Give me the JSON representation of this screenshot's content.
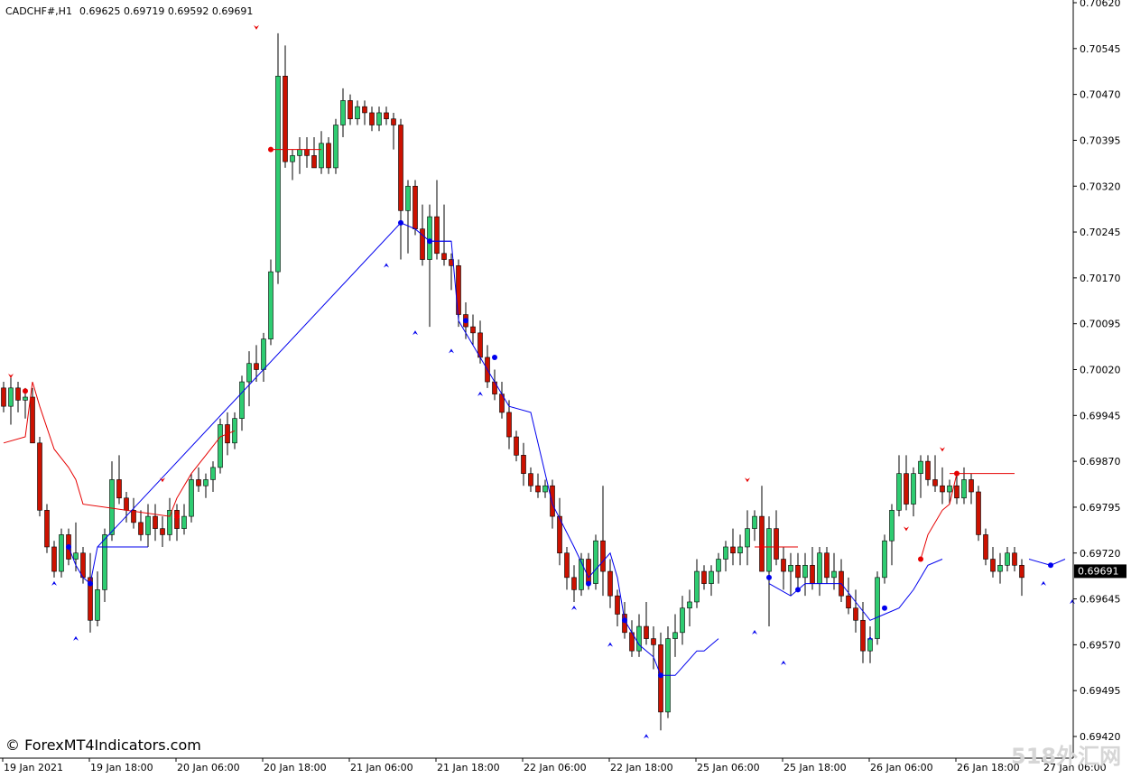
{
  "header": {
    "symbol": "CADCHF#,H1",
    "ohlc": "0.69625 0.69719 0.69592 0.69691"
  },
  "watermark": {
    "left": "© ForexMT4Indicators.com",
    "right": "518外汇网"
  },
  "colors": {
    "background": "#ffffff",
    "axis": "#000000",
    "bull_body": "#2ecc71",
    "bear_body": "#cc1100",
    "wick": "#000000",
    "resistance": "#e60000",
    "support": "#0000ee",
    "price_tag_bg": "#000000",
    "price_tag_fg": "#ffffff"
  },
  "chart_data": {
    "type": "candlestick",
    "ylim": [
      0.6942,
      0.7062
    ],
    "y_ticks": [
      "0.70620",
      "0.70545",
      "0.70470",
      "0.70395",
      "0.70320",
      "0.70245",
      "0.70170",
      "0.70095",
      "0.70020",
      "0.69945",
      "0.69870",
      "0.69795",
      "0.69720",
      "0.69645",
      "0.69570",
      "0.69495",
      "0.69420"
    ],
    "x_ticks": [
      "19 Jan 2021",
      "19 Jan 18:00",
      "20 Jan 06:00",
      "20 Jan 18:00",
      "21 Jan 06:00",
      "21 Jan 18:00",
      "22 Jan 06:00",
      "22 Jan 18:00",
      "25 Jan 06:00",
      "25 Jan 18:00",
      "26 Jan 06:00",
      "26 Jan 18:00",
      "27 Jan 06:00"
    ],
    "bar_spacing_px": 8.0,
    "last_price": "0.69691",
    "candles": [
      [
        0.6999,
        0.7,
        0.6995,
        0.6996
      ],
      [
        0.6996,
        0.7001,
        0.6993,
        0.6999
      ],
      [
        0.6999,
        0.7,
        0.6995,
        0.6997
      ],
      [
        0.6997,
        0.6999,
        0.6994,
        0.69975
      ],
      [
        0.69975,
        0.6999,
        0.699,
        0.699
      ],
      [
        0.699,
        0.6991,
        0.6978,
        0.6979
      ],
      [
        0.6979,
        0.698,
        0.6972,
        0.6973
      ],
      [
        0.6973,
        0.6974,
        0.6968,
        0.6969
      ],
      [
        0.6969,
        0.6976,
        0.6968,
        0.6975
      ],
      [
        0.6975,
        0.6976,
        0.697,
        0.6971
      ],
      [
        0.6971,
        0.6977,
        0.6969,
        0.6972
      ],
      [
        0.6972,
        0.6973,
        0.6967,
        0.6968
      ],
      [
        0.6968,
        0.6972,
        0.6959,
        0.6961
      ],
      [
        0.6961,
        0.6969,
        0.696,
        0.6966
      ],
      [
        0.6966,
        0.6976,
        0.6964,
        0.6975
      ],
      [
        0.6975,
        0.6987,
        0.6974,
        0.6984
      ],
      [
        0.6984,
        0.6988,
        0.698,
        0.6981
      ],
      [
        0.6981,
        0.6982,
        0.6977,
        0.6979
      ],
      [
        0.6979,
        0.6981,
        0.6976,
        0.6977
      ],
      [
        0.6977,
        0.6979,
        0.6974,
        0.6975
      ],
      [
        0.6975,
        0.698,
        0.6973,
        0.6978
      ],
      [
        0.6978,
        0.698,
        0.6974,
        0.6976
      ],
      [
        0.6976,
        0.6978,
        0.6973,
        0.6975
      ],
      [
        0.6975,
        0.6981,
        0.6974,
        0.6979
      ],
      [
        0.6979,
        0.698,
        0.6974,
        0.6976
      ],
      [
        0.6976,
        0.698,
        0.6975,
        0.6978
      ],
      [
        0.6978,
        0.6985,
        0.6977,
        0.6984
      ],
      [
        0.6984,
        0.6986,
        0.6982,
        0.6983
      ],
      [
        0.6983,
        0.6985,
        0.6981,
        0.6984
      ],
      [
        0.6984,
        0.6987,
        0.6982,
        0.6986
      ],
      [
        0.6986,
        0.6994,
        0.6985,
        0.6993
      ],
      [
        0.6993,
        0.6995,
        0.6988,
        0.699
      ],
      [
        0.699,
        0.6995,
        0.6989,
        0.6994
      ],
      [
        0.6994,
        0.7001,
        0.6992,
        0.7
      ],
      [
        0.7,
        0.7005,
        0.6996,
        0.7003
      ],
      [
        0.7003,
        0.7006,
        0.7,
        0.7002
      ],
      [
        0.7002,
        0.7008,
        0.7,
        0.7007
      ],
      [
        0.7007,
        0.702,
        0.7006,
        0.7018
      ],
      [
        0.7018,
        0.7057,
        0.7016,
        0.705
      ],
      [
        0.705,
        0.7055,
        0.7035,
        0.7036
      ],
      [
        0.7036,
        0.7038,
        0.7033,
        0.7037
      ],
      [
        0.7037,
        0.704,
        0.7034,
        0.7038
      ],
      [
        0.7038,
        0.704,
        0.7035,
        0.7037
      ],
      [
        0.7037,
        0.704,
        0.7035,
        0.7035
      ],
      [
        0.7035,
        0.7041,
        0.7034,
        0.7039
      ],
      [
        0.7039,
        0.704,
        0.7034,
        0.7035
      ],
      [
        0.7035,
        0.7043,
        0.7034,
        0.7042
      ],
      [
        0.7042,
        0.7048,
        0.704,
        0.7046
      ],
      [
        0.7046,
        0.7047,
        0.7042,
        0.7043
      ],
      [
        0.7043,
        0.7046,
        0.7042,
        0.7045
      ],
      [
        0.7045,
        0.7046,
        0.7042,
        0.7044
      ],
      [
        0.7044,
        0.7045,
        0.7041,
        0.7042
      ],
      [
        0.7042,
        0.7045,
        0.7041,
        0.7044
      ],
      [
        0.7044,
        0.7045,
        0.7042,
        0.7043
      ],
      [
        0.7043,
        0.7044,
        0.7038,
        0.7042
      ],
      [
        0.7042,
        0.7043,
        0.702,
        0.7028
      ],
      [
        0.7028,
        0.7033,
        0.7021,
        0.7032
      ],
      [
        0.7032,
        0.7033,
        0.7024,
        0.7025
      ],
      [
        0.7025,
        0.7029,
        0.7019,
        0.702
      ],
      [
        0.702,
        0.7029,
        0.7009,
        0.7027
      ],
      [
        0.7027,
        0.7033,
        0.702,
        0.7021
      ],
      [
        0.7021,
        0.7029,
        0.7019,
        0.702
      ],
      [
        0.702,
        0.7021,
        0.7015,
        0.7019
      ],
      [
        0.7019,
        0.702,
        0.7009,
        0.7011
      ],
      [
        0.7011,
        0.7013,
        0.7007,
        0.7009
      ],
      [
        0.7009,
        0.7011,
        0.7006,
        0.7008
      ],
      [
        0.7008,
        0.701,
        0.7003,
        0.7004
      ],
      [
        0.7004,
        0.7006,
        0.6999,
        0.7
      ],
      [
        0.7,
        0.7002,
        0.6997,
        0.6998
      ],
      [
        0.6998,
        0.7,
        0.6994,
        0.6995
      ],
      [
        0.6995,
        0.6997,
        0.6989,
        0.6991
      ],
      [
        0.6991,
        0.6992,
        0.6987,
        0.6988
      ],
      [
        0.6988,
        0.699,
        0.6983,
        0.6985
      ],
      [
        0.6985,
        0.6986,
        0.6982,
        0.6983
      ],
      [
        0.6983,
        0.6985,
        0.6981,
        0.6982
      ],
      [
        0.6982,
        0.6984,
        0.6981,
        0.6983
      ],
      [
        0.6983,
        0.6984,
        0.6976,
        0.6978
      ],
      [
        0.6978,
        0.6981,
        0.697,
        0.6972
      ],
      [
        0.6972,
        0.6973,
        0.6966,
        0.6968
      ],
      [
        0.6968,
        0.697,
        0.6964,
        0.6966
      ],
      [
        0.6966,
        0.6972,
        0.6965,
        0.6971
      ],
      [
        0.6971,
        0.6972,
        0.6966,
        0.6967
      ],
      [
        0.6967,
        0.6975,
        0.6966,
        0.6974
      ],
      [
        0.6974,
        0.6983,
        0.6965,
        0.6969
      ],
      [
        0.6969,
        0.6971,
        0.6963,
        0.6965
      ],
      [
        0.6965,
        0.6966,
        0.696,
        0.6962
      ],
      [
        0.6962,
        0.6964,
        0.6958,
        0.6959
      ],
      [
        0.6959,
        0.6961,
        0.6955,
        0.6956
      ],
      [
        0.6956,
        0.6962,
        0.6955,
        0.696
      ],
      [
        0.696,
        0.6964,
        0.6957,
        0.6958
      ],
      [
        0.6958,
        0.696,
        0.6953,
        0.6957
      ],
      [
        0.6957,
        0.6959,
        0.6943,
        0.6946
      ],
      [
        0.6946,
        0.696,
        0.6945,
        0.6958
      ],
      [
        0.6958,
        0.6962,
        0.6955,
        0.6959
      ],
      [
        0.6959,
        0.6965,
        0.6957,
        0.6963
      ],
      [
        0.6963,
        0.6966,
        0.696,
        0.6964
      ],
      [
        0.6964,
        0.6971,
        0.6963,
        0.6969
      ],
      [
        0.6969,
        0.697,
        0.6966,
        0.6967
      ],
      [
        0.6967,
        0.697,
        0.6965,
        0.6969
      ],
      [
        0.6969,
        0.6972,
        0.6967,
        0.6971
      ],
      [
        0.6971,
        0.6974,
        0.6969,
        0.6973
      ],
      [
        0.6973,
        0.6976,
        0.697,
        0.6972
      ],
      [
        0.6972,
        0.6975,
        0.697,
        0.6973
      ],
      [
        0.6973,
        0.6979,
        0.697,
        0.6976
      ],
      [
        0.6976,
        0.6979,
        0.6974,
        0.6978
      ],
      [
        0.6978,
        0.6983,
        0.6969,
        0.6969
      ],
      [
        0.6969,
        0.6978,
        0.696,
        0.6976
      ],
      [
        0.6976,
        0.6979,
        0.697,
        0.6971
      ],
      [
        0.6971,
        0.6973,
        0.6966,
        0.6969
      ],
      [
        0.6969,
        0.6972,
        0.6965,
        0.697
      ],
      [
        0.697,
        0.6972,
        0.6966,
        0.6968
      ],
      [
        0.6968,
        0.6972,
        0.6965,
        0.697
      ],
      [
        0.697,
        0.6973,
        0.6966,
        0.6967
      ],
      [
        0.6967,
        0.6973,
        0.6965,
        0.6972
      ],
      [
        0.6972,
        0.6973,
        0.6967,
        0.6968
      ],
      [
        0.6968,
        0.6972,
        0.6966,
        0.6969
      ],
      [
        0.6969,
        0.6971,
        0.6964,
        0.6965
      ],
      [
        0.6965,
        0.6968,
        0.6962,
        0.6963
      ],
      [
        0.6963,
        0.6966,
        0.6959,
        0.6961
      ],
      [
        0.6961,
        0.6964,
        0.6954,
        0.6956
      ],
      [
        0.6956,
        0.696,
        0.6954,
        0.6958
      ],
      [
        0.6958,
        0.6969,
        0.6957,
        0.6968
      ],
      [
        0.6968,
        0.6975,
        0.6967,
        0.6974
      ],
      [
        0.6974,
        0.698,
        0.697,
        0.6979
      ],
      [
        0.6979,
        0.6988,
        0.6978,
        0.6985
      ],
      [
        0.6985,
        0.6988,
        0.6979,
        0.698
      ],
      [
        0.698,
        0.6986,
        0.6978,
        0.6985
      ],
      [
        0.6985,
        0.6988,
        0.6981,
        0.6987
      ],
      [
        0.6987,
        0.6988,
        0.6983,
        0.6984
      ],
      [
        0.6984,
        0.6988,
        0.6982,
        0.6983
      ],
      [
        0.6983,
        0.6986,
        0.698,
        0.6982
      ],
      [
        0.6982,
        0.6984,
        0.698,
        0.6983
      ],
      [
        0.6983,
        0.6985,
        0.698,
        0.6981
      ],
      [
        0.6981,
        0.6986,
        0.698,
        0.6984
      ],
      [
        0.6984,
        0.6985,
        0.698,
        0.6982
      ],
      [
        0.6982,
        0.6983,
        0.6974,
        0.6975
      ],
      [
        0.6975,
        0.6976,
        0.697,
        0.6971
      ],
      [
        0.6971,
        0.6973,
        0.6968,
        0.6969
      ],
      [
        0.6969,
        0.6972,
        0.6967,
        0.697
      ],
      [
        0.697,
        0.6973,
        0.6969,
        0.6972
      ],
      [
        0.6972,
        0.6973,
        0.6969,
        0.697
      ],
      [
        0.697,
        0.6971,
        0.6965,
        0.6968
      ]
    ],
    "resistance_line": [
      [
        0,
        0.699
      ],
      [
        3,
        0.6991
      ],
      [
        4,
        0.7
      ],
      [
        5,
        0.6996
      ],
      [
        7,
        0.6989
      ],
      [
        9,
        0.6986
      ],
      [
        10,
        0.6984
      ],
      [
        11,
        0.698
      ],
      [
        23,
        0.6978
      ],
      [
        24,
        0.6981
      ],
      [
        26,
        0.6985
      ],
      [
        28,
        0.6988
      ],
      [
        30,
        0.6991
      ],
      [
        32,
        0.6992
      ]
    ],
    "resistance_steps": [
      [
        37,
        44,
        0.7038
      ],
      [
        104,
        110,
        0.6973
      ],
      [
        131,
        140,
        0.6985
      ]
    ],
    "resistance_dots": [
      [
        3,
        0.69985
      ],
      [
        24,
        0.6978
      ],
      [
        37,
        0.7038
      ],
      [
        105,
        0.6973
      ],
      [
        127,
        0.6971
      ],
      [
        132,
        0.6985
      ]
    ],
    "resistance_curve2": [
      [
        127,
        0.6971
      ],
      [
        128,
        0.6975
      ],
      [
        130,
        0.6979
      ],
      [
        131,
        0.698
      ],
      [
        132,
        0.6985
      ]
    ],
    "support_steps": [
      [
        13,
        20,
        0.6973
      ],
      [
        59,
        62,
        0.7023
      ]
    ],
    "support_line": [
      [
        9,
        0.6973
      ],
      [
        10,
        0.697
      ],
      [
        11,
        0.6968
      ],
      [
        12,
        0.6967
      ],
      [
        13,
        0.6973
      ],
      [
        55,
        0.7026
      ],
      [
        57,
        0.7025
      ],
      [
        59,
        0.7023
      ],
      [
        62,
        0.7023
      ],
      [
        63,
        0.701
      ],
      [
        64,
        0.7008
      ],
      [
        66,
        0.7004
      ],
      [
        70,
        0.6996
      ],
      [
        73,
        0.6995
      ],
      [
        75,
        0.6985
      ],
      [
        76,
        0.698
      ],
      [
        79,
        0.6973
      ],
      [
        81,
        0.6968
      ],
      [
        84,
        0.6972
      ],
      [
        85,
        0.6968
      ],
      [
        86,
        0.6961
      ],
      [
        88,
        0.6957
      ],
      [
        90,
        0.6955
      ],
      [
        91,
        0.6952
      ],
      [
        93,
        0.6952
      ],
      [
        96,
        0.6956
      ],
      [
        97,
        0.6956
      ],
      [
        99,
        0.6958
      ]
    ],
    "support_line2": [
      [
        106,
        0.6967
      ],
      [
        109,
        0.6965
      ],
      [
        111,
        0.6967
      ],
      [
        114,
        0.6967
      ],
      [
        116,
        0.6967
      ],
      [
        118,
        0.6964
      ],
      [
        120,
        0.6961
      ],
      [
        122,
        0.6962
      ],
      [
        124,
        0.6963
      ],
      [
        126,
        0.6966
      ],
      [
        128,
        0.697
      ],
      [
        130,
        0.6971
      ]
    ],
    "support_dots": [
      [
        9,
        0.6973
      ],
      [
        12,
        0.6967
      ],
      [
        55,
        0.7026
      ],
      [
        59,
        0.7023
      ],
      [
        64,
        0.701
      ],
      [
        68,
        0.7004
      ],
      [
        81,
        0.6967
      ],
      [
        86,
        0.6961
      ],
      [
        91,
        0.6952
      ],
      [
        106,
        0.6968
      ],
      [
        110,
        0.6966
      ],
      [
        122,
        0.6963
      ],
      [
        145,
        0.697
      ]
    ],
    "support_lines3": [
      [
        142,
        0.6971
      ],
      [
        145,
        0.697
      ],
      [
        147,
        0.6971
      ]
    ],
    "fractal_up": [
      [
        1,
        0.7
      ],
      [
        22,
        0.6983
      ],
      [
        35,
        0.7057
      ],
      [
        103,
        0.6983
      ],
      [
        125,
        0.6975
      ],
      [
        130,
        0.6988
      ]
    ],
    "fractal_down": [
      [
        7,
        0.6968
      ],
      [
        10,
        0.6959
      ],
      [
        53,
        0.702
      ],
      [
        57,
        0.7009
      ],
      [
        62,
        0.7006
      ],
      [
        66,
        0.6999
      ],
      [
        79,
        0.6964
      ],
      [
        84,
        0.6958
      ],
      [
        89,
        0.6943
      ],
      [
        104,
        0.696
      ],
      [
        108,
        0.6955
      ],
      [
        120,
        0.6959
      ],
      [
        144,
        0.6968
      ],
      [
        148,
        0.6965
      ]
    ]
  }
}
